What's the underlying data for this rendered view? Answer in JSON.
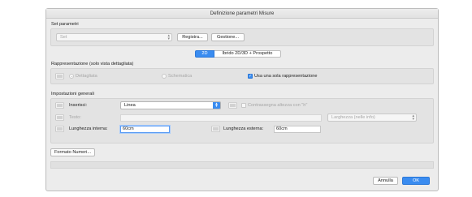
{
  "dialog": {
    "title": "Definizione parametri Misure"
  },
  "set": {
    "header": "Set parametri",
    "popup_value": "Set",
    "register_button": "Registra...",
    "manage_button": "Gestione..."
  },
  "tabs": [
    {
      "label": "2D"
    },
    {
      "label": "Ibrido 2D/3D + Prospetto"
    }
  ],
  "representation": {
    "header": "Rappresentazione (solo vista dettagliata)",
    "radio_detailed": "Dettagliata",
    "radio_schematic": "Schematica",
    "checkbox_single": "Usa una sola rappresentazione"
  },
  "general": {
    "header": "Impostazioni generali",
    "insert_label": "Inserisci:",
    "insert_value": "Linea",
    "height_checkbox": "Contrassegna altezza con \"h\"",
    "text_label": "Testo:",
    "text_popup": "Larghezza (nelle info)",
    "inner_length_label": "Lunghezza interna:",
    "inner_length_value": "60cm",
    "outer_length_label": "Lunghezza esterna:",
    "outer_length_value": "60cm"
  },
  "footer": {
    "format_button": "Formato Numeri...",
    "cancel_button": "Annulla",
    "ok_button": "OK"
  },
  "colors": {
    "accent": "#3a8cf0"
  }
}
